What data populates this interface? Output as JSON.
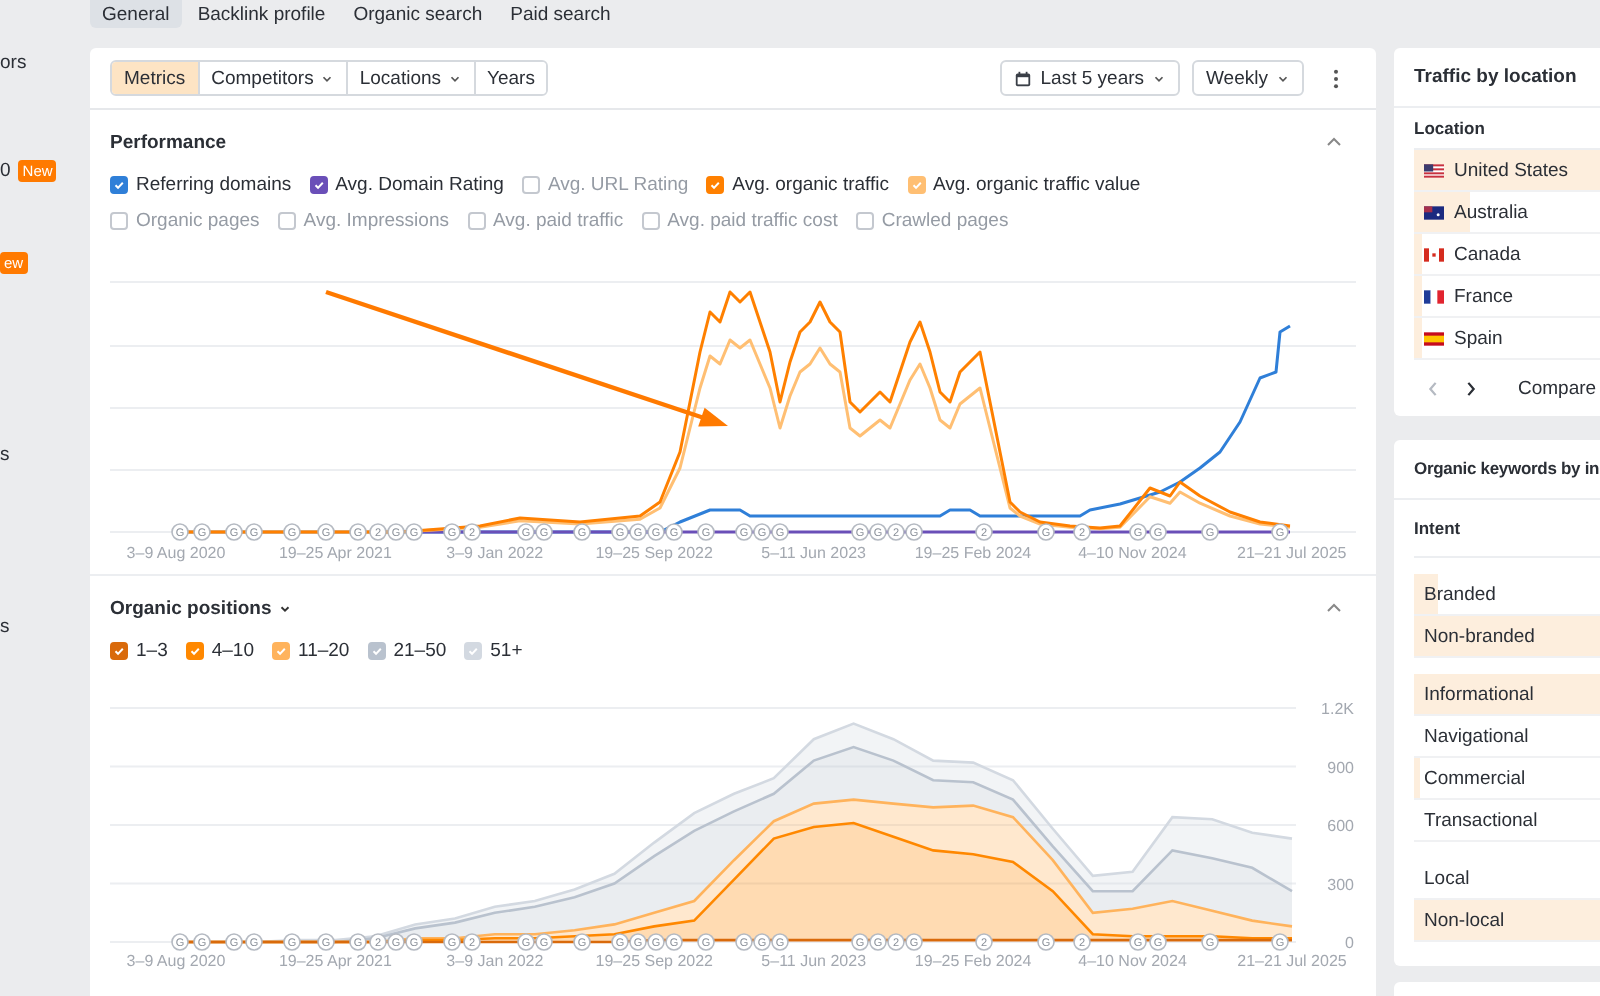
{
  "sidebar_fragments": [
    {
      "text": "ors"
    },
    {
      "text": "0",
      "badge": "New"
    },
    {
      "badge": "ew"
    },
    {
      "text": "s"
    },
    {
      "text": "s"
    }
  ],
  "tabs": [
    {
      "label": "General",
      "selected": true
    },
    {
      "label": "Backlink profile",
      "selected": false
    },
    {
      "label": "Organic search",
      "selected": false
    },
    {
      "label": "Paid search",
      "selected": false
    }
  ],
  "toolbar": {
    "segments": [
      {
        "label": "Metrics",
        "selected": true,
        "dropdown": false
      },
      {
        "label": "Competitors",
        "selected": false,
        "dropdown": true
      },
      {
        "label": "Locations",
        "selected": false,
        "dropdown": true
      },
      {
        "label": "Years",
        "selected": false,
        "dropdown": false
      }
    ],
    "period": "Last 5 years",
    "interval": "Weekly"
  },
  "performance": {
    "title": "Performance",
    "expanded": true,
    "metrics": [
      {
        "label": "Referring domains",
        "checked": true,
        "color": "#2f7fd8"
      },
      {
        "label": "Avg. Domain Rating",
        "checked": true,
        "color": "#6a4fb8"
      },
      {
        "label": "Avg. URL Rating",
        "checked": false
      },
      {
        "label": "Avg. organic traffic",
        "checked": true,
        "color": "#ff8000"
      },
      {
        "label": "Avg. organic traffic value",
        "checked": true,
        "color": "#ffbf73"
      },
      {
        "label": "Organic pages",
        "checked": false
      },
      {
        "label": "Avg. Impressions",
        "checked": false
      },
      {
        "label": "Avg. paid traffic",
        "checked": false
      },
      {
        "label": "Avg. paid traffic cost",
        "checked": false
      },
      {
        "label": "Crawled pages",
        "checked": false
      }
    ],
    "x_labels": [
      "3–9 Aug 2020",
      "19–25 Apr 2021",
      "3–9 Jan 2022",
      "19–25 Sep 2022",
      "5–11 Jun 2023",
      "19–25 Feb 2024",
      "4–10 Nov 2024",
      "21–21 Jul 2025"
    ],
    "update_markers": [
      "G",
      "G",
      "G",
      "G",
      "G",
      "G",
      "G",
      "2",
      "G",
      "G",
      "G",
      "2",
      "G",
      "G",
      "G",
      "G",
      "G",
      "G",
      "G",
      "G",
      "G",
      "G",
      "G",
      "G",
      "G",
      "2",
      "G",
      "2",
      "G",
      "2",
      "G",
      "G",
      "G",
      "G"
    ]
  },
  "organic_positions": {
    "title": "Organic positions",
    "expanded": true,
    "legend": [
      {
        "checked": true
      },
      {
        "checked": true
      },
      {
        "checked": true
      },
      {
        "checked": true
      },
      {
        "checked": true
      }
    ],
    "chart_data": {
      "type": "area",
      "stacked": true,
      "grid": true,
      "categories": [
        "3–9 Aug 2020",
        null,
        null,
        null,
        "19–25 Apr 2021",
        null,
        null,
        null,
        "3–9 Jan 2022",
        null,
        null,
        null,
        "19–25 Sep 2022",
        null,
        null,
        null,
        "5–11 Jun 2023",
        null,
        null,
        null,
        "19–25 Feb 2024",
        null,
        null,
        null,
        "4–10 Nov 2024",
        null,
        null,
        null,
        "21–21 Jul 2025"
      ],
      "series": [
        {
          "name": "1–3",
          "color": "#d96a0b",
          "values": [
            0,
            0,
            0,
            0,
            0,
            0,
            0,
            0,
            0,
            0,
            0,
            0,
            10,
            10,
            10,
            10,
            10,
            10,
            10,
            10,
            10,
            10,
            10,
            10,
            10,
            10,
            10,
            10,
            10
          ]
        },
        {
          "name": "4–10",
          "color": "#ff8800",
          "values": [
            0,
            0,
            0,
            0,
            0,
            0,
            10,
            10,
            20,
            20,
            30,
            40,
            70,
            100,
            310,
            520,
            580,
            600,
            530,
            460,
            440,
            400,
            250,
            30,
            20,
            20,
            20,
            10,
            10
          ]
        },
        {
          "name": "11–20",
          "color": "#ffb35c",
          "values": [
            0,
            0,
            0,
            0,
            0,
            0,
            10,
            10,
            20,
            20,
            30,
            50,
            70,
            100,
            100,
            90,
            120,
            120,
            170,
            220,
            250,
            230,
            160,
            110,
            140,
            180,
            130,
            90,
            60
          ]
        },
        {
          "name": "21–50",
          "color": "#b9c2ce",
          "values": [
            0,
            0,
            0,
            0,
            0,
            20,
            50,
            80,
            110,
            140,
            170,
            210,
            290,
            360,
            250,
            140,
            220,
            270,
            220,
            140,
            120,
            90,
            70,
            110,
            90,
            260,
            270,
            270,
            180
          ]
        },
        {
          "name": "51+",
          "color": "#d3d9e1",
          "values": [
            0,
            0,
            0,
            10,
            10,
            10,
            20,
            20,
            30,
            30,
            40,
            50,
            70,
            90,
            90,
            80,
            110,
            120,
            110,
            100,
            100,
            100,
            90,
            80,
            100,
            170,
            200,
            180,
            270
          ]
        }
      ],
      "ylim": [
        0,
        1200
      ],
      "yticks": [
        0,
        300,
        600,
        900,
        {
          "value": 1200,
          "label": "1.2K"
        }
      ]
    },
    "update_markers": [
      "G",
      "G",
      "G",
      "G",
      "G",
      "G",
      "G",
      "2",
      "G",
      "G",
      "G",
      "2",
      "G",
      "G",
      "G",
      "G",
      "G",
      "G",
      "G",
      "G",
      "G",
      "G",
      "G",
      "G",
      "G",
      "2",
      "G",
      "2",
      "G",
      "2",
      "G",
      "G",
      "G",
      "G"
    ]
  },
  "traffic_by_location": {
    "title": "Traffic by location",
    "column": "Location",
    "rows": [
      {
        "name": "United States",
        "level": 1
      },
      {
        "name": "Australia",
        "level": 0.3
      },
      {
        "name": "Canada",
        "level": 0.04
      },
      {
        "name": "France",
        "level": 0.04
      },
      {
        "name": "Spain",
        "level": 0.04
      }
    ],
    "prev_disabled": true,
    "compare": "Compare"
  },
  "organic_keywords": {
    "title": "Organic keywords by in",
    "column": "Intent",
    "groups": [
      {
        "rows": [
          {
            "name": "Branded",
            "level": 0.13
          },
          {
            "name": "Non-branded",
            "level": 1
          }
        ]
      },
      {
        "rows": [
          {
            "name": "Informational",
            "level": 1
          },
          {
            "name": "Navigational"
          },
          {
            "name": "Commercial",
            "level": 0.03
          },
          {
            "name": "Transactional"
          }
        ]
      },
      {
        "rows": [
          {
            "name": "Local"
          },
          {
            "name": "Non-local",
            "level": 1
          }
        ]
      }
    ]
  }
}
